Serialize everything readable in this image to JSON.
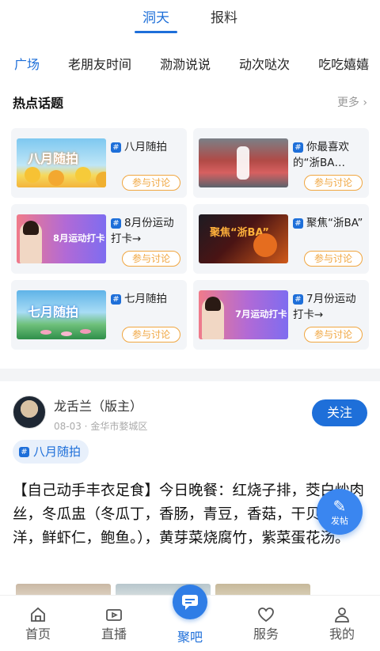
{
  "top_tabs": [
    {
      "label": "洞天",
      "active": true
    },
    {
      "label": "报料",
      "active": false
    }
  ],
  "channels": [
    {
      "label": "广场",
      "active": true
    },
    {
      "label": "老朋友时间",
      "active": false
    },
    {
      "label": "泐泐说说",
      "active": false
    },
    {
      "label": "动次哒次",
      "active": false
    },
    {
      "label": "吃吃嬉嬉",
      "active": false
    }
  ],
  "hot_topics": {
    "title": "热点话题",
    "more_label": "更多 ›",
    "join_label": "参与讨论",
    "items": [
      {
        "title": "八月随拍",
        "thumb_text": "八月随拍"
      },
      {
        "title": "你最喜欢的“浙BA…",
        "thumb_text": ""
      },
      {
        "title": "8月份运动打卡→",
        "thumb_text": "8月运动打卡"
      },
      {
        "title": "聚焦“浙BA”",
        "thumb_text": "聚焦“浙BA”"
      },
      {
        "title": "七月随拍",
        "thumb_text": "七月随拍"
      },
      {
        "title": "7月份运动打卡→",
        "thumb_text": "7月运动打卡"
      }
    ]
  },
  "post": {
    "author": "龙舌兰（版主）",
    "meta": "08-03 · 金华市婺城区",
    "follow_label": "关注",
    "topic": "八月随拍",
    "body": "【自己动手丰衣足食】今日晚餐：红烧子排，茭白炒肉丝，冬瓜盅（冬瓜丁，香肠，青豆，香菇，干贝，开洋，鲜虾仁，鲍鱼。），黄芽菜烧腐竹，紫菜蛋花汤。"
  },
  "fab": {
    "label": "发帖",
    "icon": "pencil-icon"
  },
  "bottom_nav": [
    {
      "label": "首页",
      "icon": "home-icon",
      "active": false
    },
    {
      "label": "直播",
      "icon": "live-icon",
      "active": false
    },
    {
      "label": "聚吧",
      "icon": "chat-icon",
      "active": true
    },
    {
      "label": "服务",
      "icon": "heart-icon",
      "active": false
    },
    {
      "label": "我的",
      "icon": "user-icon",
      "active": false
    }
  ],
  "colors": {
    "accent": "#1e6fd9",
    "join_border": "#f0a640"
  }
}
